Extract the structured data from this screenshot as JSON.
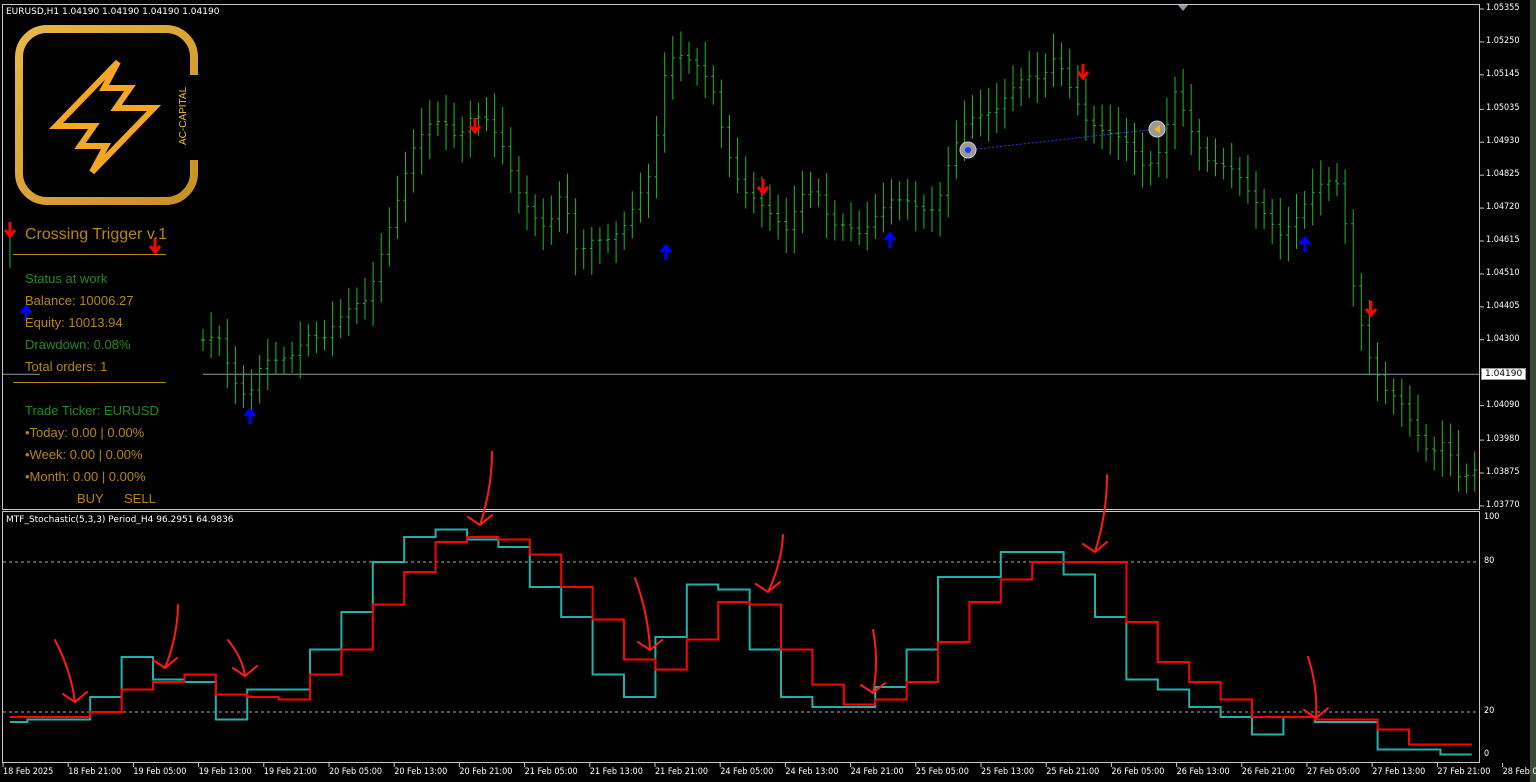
{
  "header": {
    "symbol_line": "EURUSD,H1  1.04190 1.04190 1.04190 1.04190"
  },
  "logo": {
    "brand": "AC-CAPITAL",
    "icon": "lightning-bolt-icon"
  },
  "panel": {
    "title": "Crossing Trigger v.1",
    "status": "Status at work",
    "balance": "Balance: 10006.27",
    "equity": "Equity: 10013.94",
    "drawdown": "Drawdown: 0.08%",
    "total_orders": "Total orders: 1",
    "ticker": "Trade Ticker: EURUSD",
    "today": "•Today: 0.00 | 0.00%",
    "week": "•Week: 0.00 | 0.00%",
    "month": "•Month: 0.00 | 0.00%",
    "buy_label": "BUY",
    "sell_label": "SELL"
  },
  "indicator": {
    "label": "MTF_Stochastic(5,3,3) Period_H4 96.2951 64.9836"
  },
  "colors": {
    "bars": "#22b822",
    "main_line": "#20b2aa",
    "signal_line": "#ff0000",
    "sell_arrow": "#ff0000",
    "buy_arrow": "#0000ff",
    "panel_gold": "#b8860b",
    "panel_green": "#1e8c1e"
  },
  "chart_data": [
    {
      "type": "ohlc-bar",
      "symbol": "EURUSD",
      "timeframe": "H1",
      "current_price": "1.04190",
      "ylim": [
        1.0377,
        1.05355
      ],
      "y_ticks": [
        "1.05355",
        "1.05250",
        "1.05145",
        "1.05035",
        "1.04930",
        "1.04825",
        "1.04720",
        "1.04615",
        "1.04510",
        "1.04405",
        "1.04300",
        "1.04190",
        "1.04090",
        "1.03980",
        "1.03875",
        "1.03770"
      ],
      "x_ticks": [
        "18 Feb 2025",
        "18 Feb 21:00",
        "19 Feb 05:00",
        "19 Feb 13:00",
        "19 Feb 21:00",
        "20 Feb 05:00",
        "20 Feb 13:00",
        "20 Feb 21:00",
        "21 Feb 05:00",
        "21 Feb 13:00",
        "21 Feb 21:00",
        "24 Feb 05:00",
        "24 Feb 13:00",
        "24 Feb 21:00",
        "25 Feb 05:00",
        "25 Feb 13:00",
        "25 Feb 21:00",
        "26 Feb 05:00",
        "26 Feb 13:00",
        "26 Feb 21:00",
        "27 Feb 05:00",
        "27 Feb 13:00",
        "27 Feb 21:00",
        "28 Feb 05:00"
      ],
      "close_path": [
        1.04299,
        1.04315,
        1.04172,
        1.04108,
        1.04235,
        1.04235,
        1.04251,
        1.04315,
        1.04299,
        1.04363,
        1.04411,
        1.04427,
        1.04586,
        1.04746,
        1.04905,
        1.04985,
        1.05001,
        1.04937,
        1.05017,
        1.05001,
        1.04921,
        1.04778,
        1.04698,
        1.0465,
        1.04778,
        1.0457,
        1.04618,
        1.04618,
        1.0465,
        1.04746,
        1.04841,
        1.05192,
        1.05208,
        1.05176,
        1.05113,
        1.04905,
        1.04778,
        1.04746,
        1.04698,
        1.0465,
        1.04762,
        1.04778,
        1.04666,
        1.04666,
        1.04634,
        1.04698,
        1.04746,
        1.04746,
        1.04714,
        1.04714,
        1.04889,
        1.05001,
        1.05017,
        1.05033,
        1.05097,
        1.05144,
        1.05129,
        1.05208,
        1.05097,
        1.05001,
        1.04969,
        1.04953,
        1.04921,
        1.04841,
        1.04905,
        1.05097,
        1.04969,
        1.04873,
        1.04857,
        1.04841,
        1.04762,
        1.04698,
        1.04634,
        1.04682,
        1.04762,
        1.0481,
        1.04794,
        1.04427,
        1.04235,
        1.0414,
        1.04108,
        1.04012,
        1.03932,
        1.0398,
        1.03853,
        1.03885
      ]
    },
    {
      "type": "line",
      "title": "MTF_Stochastic(5,3,3) Period_H4",
      "ylim": [
        0,
        100
      ],
      "y_ticks": [
        "100",
        "80",
        "20",
        "0"
      ],
      "levels": [
        80,
        20
      ],
      "series": [
        {
          "values": [
            16,
            17,
            17,
            26,
            42,
            33,
            32,
            17,
            29,
            29,
            45,
            60,
            80,
            90,
            93,
            89,
            86,
            70,
            58,
            35,
            26,
            50,
            71,
            69,
            45,
            26,
            22,
            22,
            30,
            45,
            74,
            74,
            84,
            84,
            75,
            58,
            33,
            29,
            22,
            18,
            11,
            18,
            16,
            16,
            5,
            5,
            3
          ]
        },
        {
          "values": [
            18,
            18,
            18,
            20,
            29,
            32,
            35,
            27,
            26,
            25,
            35,
            45,
            63,
            76,
            88,
            90,
            89,
            83,
            70,
            57,
            41,
            37,
            49,
            64,
            63,
            45,
            31,
            23,
            25,
            32,
            48,
            64,
            73,
            80,
            80,
            80,
            56,
            40,
            32,
            25,
            18,
            18,
            17,
            17,
            13,
            7,
            7
          ]
        }
      ]
    }
  ]
}
